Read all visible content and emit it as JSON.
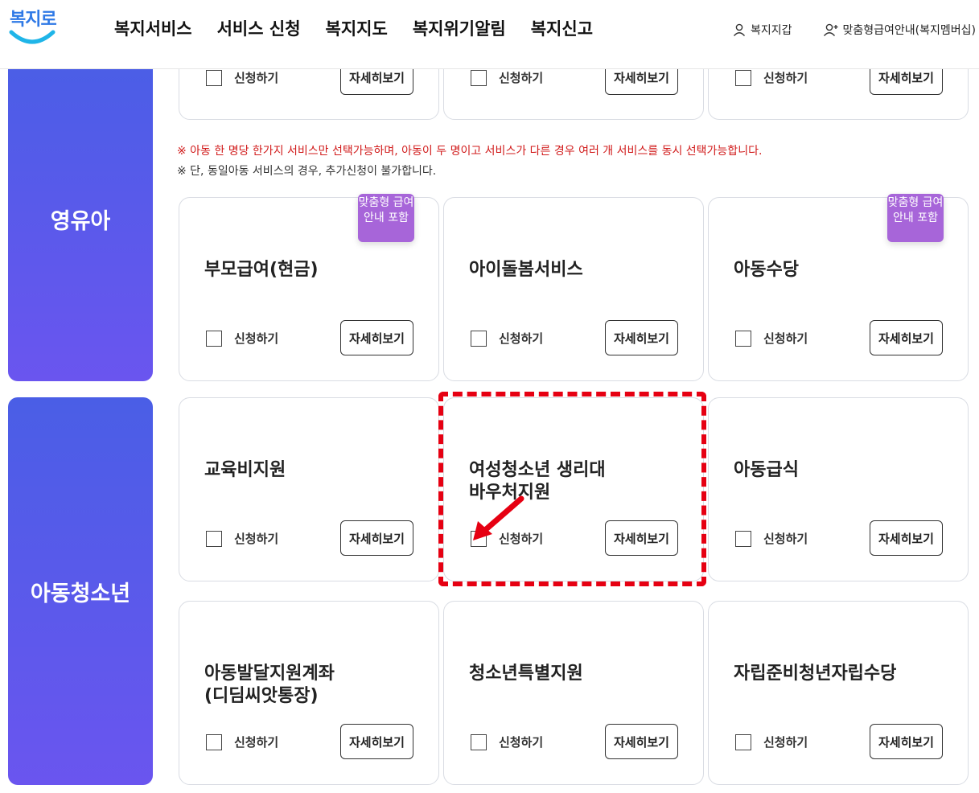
{
  "header": {
    "logo_text": "복지로",
    "nav": [
      "복지서비스",
      "서비스 신청",
      "복지지도",
      "복지위기알림",
      "복지신고"
    ],
    "util": {
      "wallet": "복지지갑",
      "membership": "맞춤형급여안내(복지멤버십)"
    }
  },
  "categories": {
    "infant": "영유아",
    "youth": "아동청소년"
  },
  "notices": {
    "red": "※ 아동 한 명당 한가지 서비스만 선택가능하며, 아동이 두 명이고 서비스가 다른 경우 여러 개 서비스를 동시 선택가능합니다.",
    "dark": "※ 단, 동일아동 서비스의 경우, 추가신청이 불가합니다."
  },
  "labels": {
    "apply": "신청하기",
    "detail": "자세히보기"
  },
  "badge_text": "맞춤형 급여안내 포함",
  "cards": {
    "parent_benefit": "부모급여(현금)",
    "childcare": "아이돌봄서비스",
    "child_allowance": "아동수당",
    "education": "교육비지원",
    "sanitary": "여성청소년 생리대 바우처지원",
    "meal": "아동급식",
    "didim": "아동발달지원계좌(디딤씨앗통장)",
    "teen_special": "청소년특별지원",
    "independence": "자립준비청년자립수당"
  },
  "colors": {
    "category_gradient_top": "#4a5ee6",
    "category_gradient_bottom": "#6a55ef",
    "badge": "#a765d9",
    "notice_red": "#d11b1b",
    "highlight": "#e60012"
  }
}
